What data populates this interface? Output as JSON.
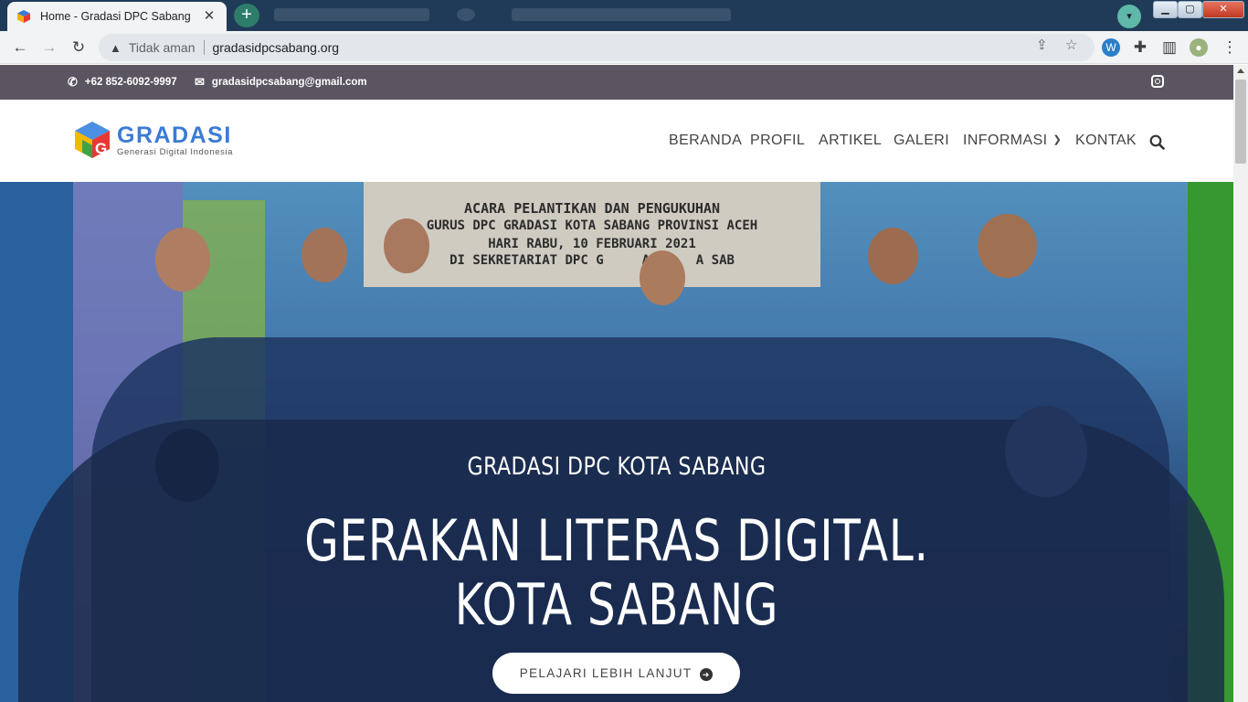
{
  "browser": {
    "tab_title": "Home - Gradasi DPC Sabang",
    "tab_close": "✕",
    "new_tab": "+",
    "security_label": "Tidak aman",
    "url": "gradasidpcsabang.org"
  },
  "topbar": {
    "phone": "+62 852-6092-9997",
    "email": "gradasidpcsabang@gmail.com"
  },
  "logo": {
    "name": "GRADASI",
    "tagline": "Generasi Digital Indonesia"
  },
  "nav": {
    "items": [
      "BERANDA",
      "PROFIL",
      "ARTIKEL",
      "GALERI",
      "INFORMASI",
      "KONTAK"
    ]
  },
  "hero": {
    "subtitle": "GRADASI DPC KOTA SABANG",
    "title_line1": "GERAKAN LITERAS DIGITAL.",
    "title_line2": "KOTA SABANG",
    "button_label": "PELAJARI LEBIH LANJUT",
    "banner_line1": "ACARA PELANTIKAN DAN PENGUKUHAN",
    "banner_line2": "GURUS DPC GRADASI KOTA SABANG PROVINSI ACEH",
    "banner_line3": "HARI RABU, 10 FEBRUARI 2021",
    "banner_line4": "DI SEKRETARIAT DPC G     AS     A SAB"
  },
  "colors": {
    "topbar_bg": "#5a5561",
    "logo_blue": "#3a7bd5",
    "tab_strip": "#1f3b57"
  }
}
